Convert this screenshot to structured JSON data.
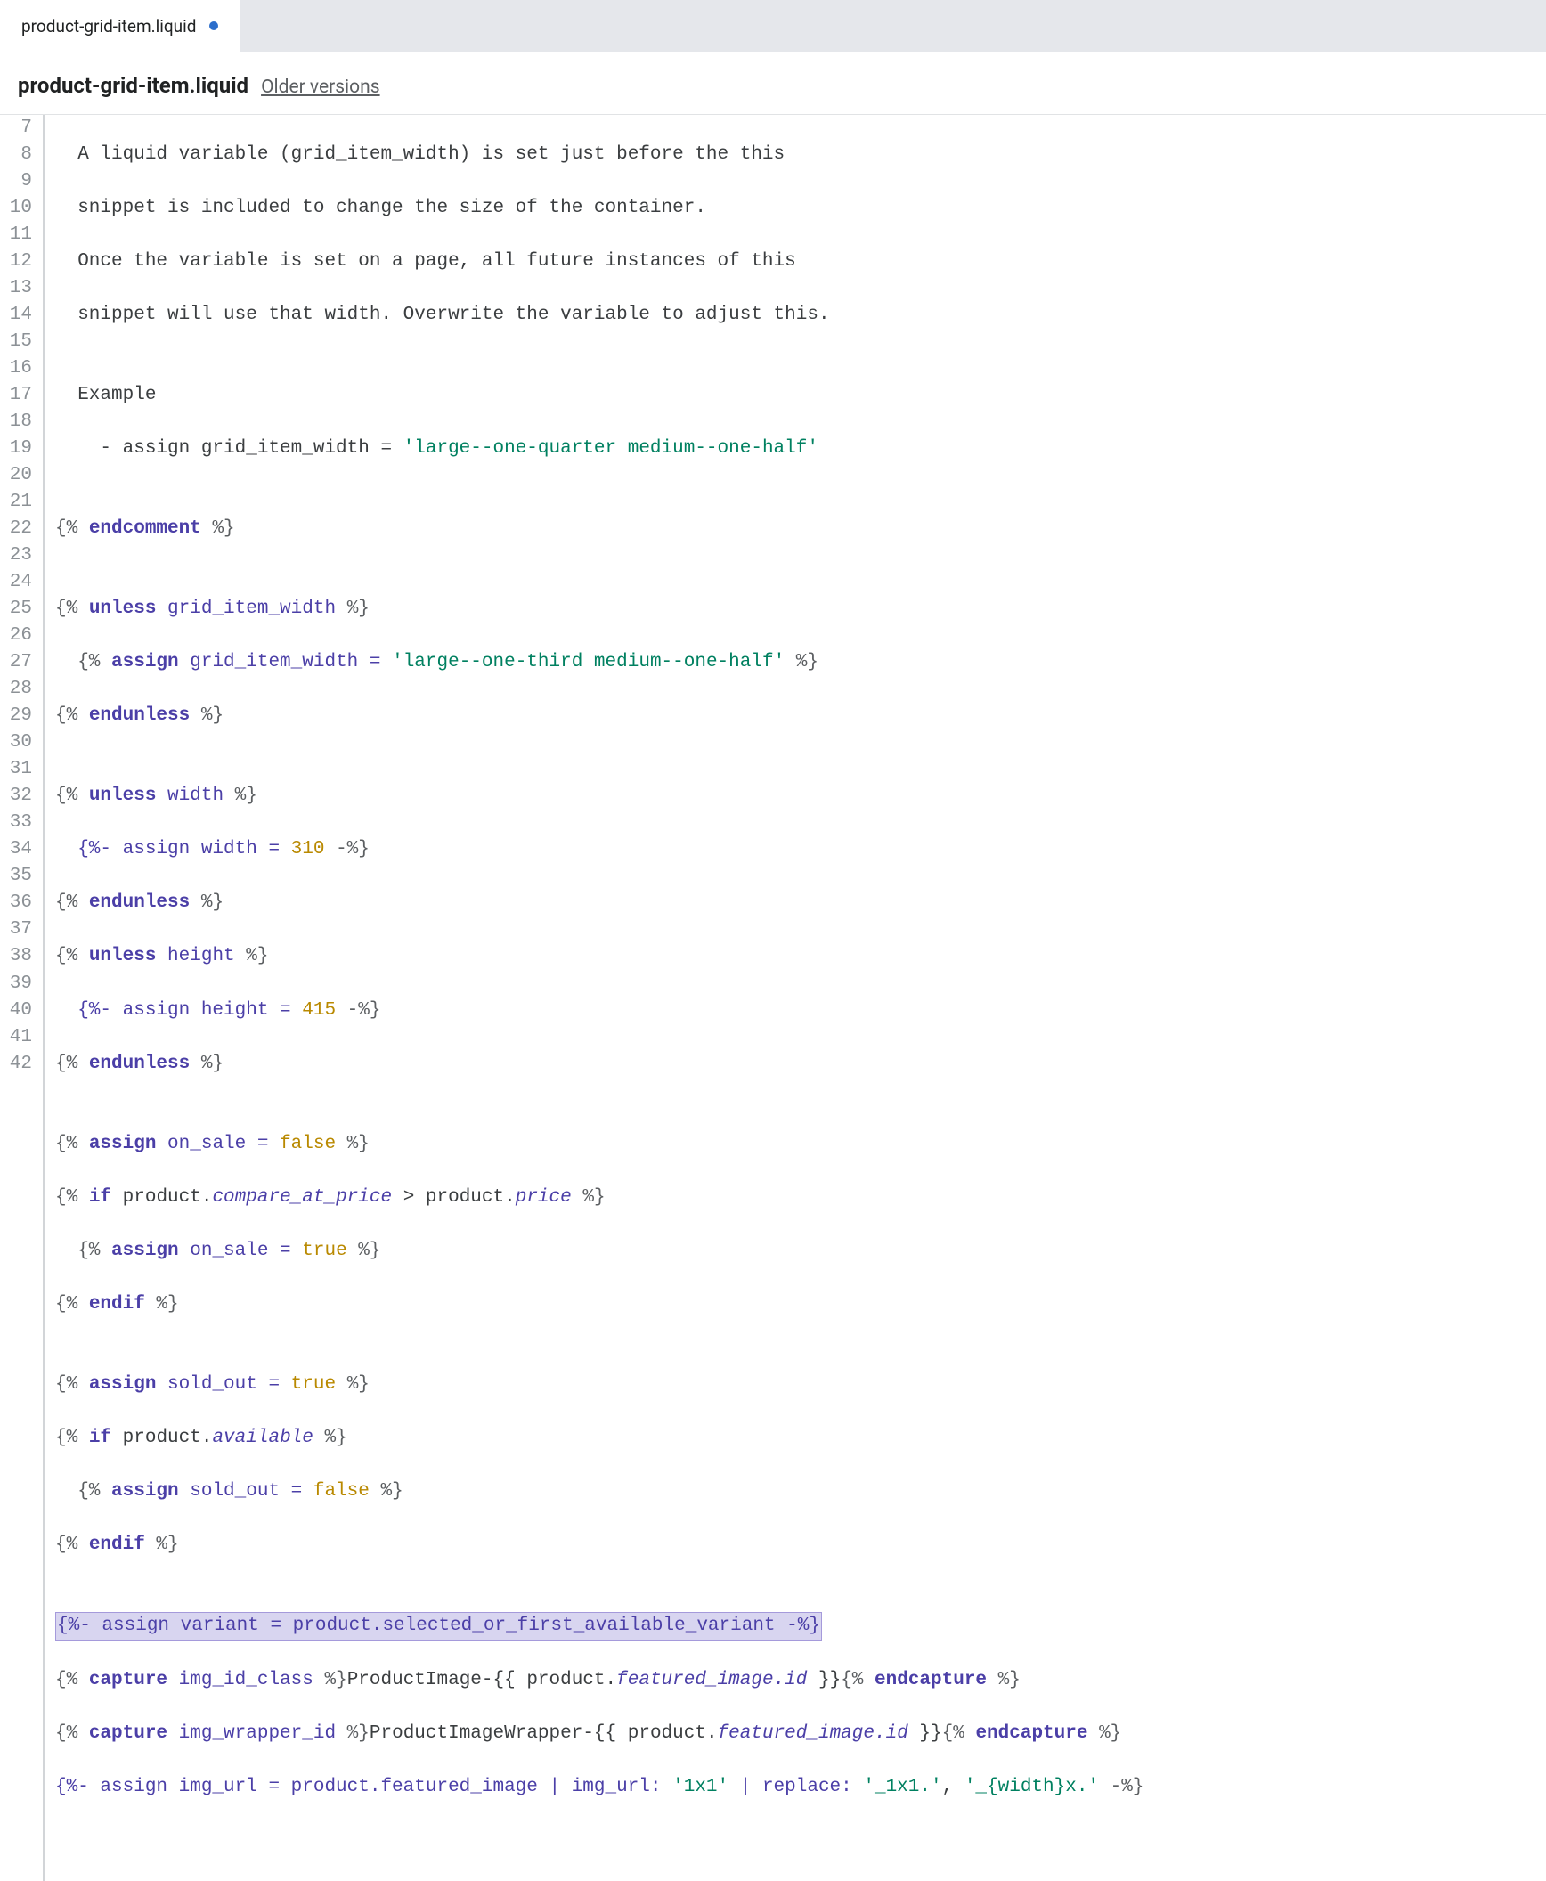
{
  "tab": {
    "label": "product-grid-item.liquid",
    "modified": true
  },
  "header": {
    "title": "product-grid-item.liquid",
    "older_versions": "Older versions"
  },
  "gutter": {
    "start": 7,
    "end": 42
  },
  "code": {
    "l7": "  A liquid variable (grid_item_width) is set just before the this",
    "l8": "  snippet is included to change the size of the container.",
    "l9": "  Once the variable is set on a page, all future instances of this",
    "l10": "  snippet will use that width. Overwrite the variable to adjust this.",
    "l11": "",
    "l12": "  Example",
    "l13_a": "    - assign grid_item_width = ",
    "l13_b": "'large--one-quarter medium--one-half'",
    "l14": "",
    "l15_a": "{% ",
    "l15_b": "endcomment",
    "l15_c": " %}",
    "l16": "",
    "l17_a": "{% ",
    "l17_b": "unless",
    "l17_c": " grid_item_width ",
    "l17_d": "%}",
    "l18_a": "  {% ",
    "l18_b": "assign",
    "l18_c": " grid_item_width = ",
    "l18_d": "'large--one-third medium--one-half'",
    "l18_e": " %}",
    "l19_a": "{% ",
    "l19_b": "endunless",
    "l19_c": " %}",
    "l20": "",
    "l21_a": "{% ",
    "l21_b": "unless",
    "l21_c": " width ",
    "l21_d": "%}",
    "l22_a": "  {%- assign width = ",
    "l22_b": "310",
    "l22_c": " -%}",
    "l23_a": "{% ",
    "l23_b": "endunless",
    "l23_c": " %}",
    "l24_a": "{% ",
    "l24_b": "unless",
    "l24_c": " height ",
    "l24_d": "%}",
    "l25_a": "  {%- assign height = ",
    "l25_b": "415",
    "l25_c": " -%}",
    "l26_a": "{% ",
    "l26_b": "endunless",
    "l26_c": " %}",
    "l27": "",
    "l28_a": "{% ",
    "l28_b": "assign",
    "l28_c": " on_sale = ",
    "l28_d": "false",
    "l28_e": " %}",
    "l29_a": "{% ",
    "l29_b": "if",
    "l29_c": " product.",
    "l29_d": "compare_at_price",
    "l29_e": " > product.",
    "l29_f": "price",
    "l29_g": " %}",
    "l30_a": "  {% ",
    "l30_b": "assign",
    "l30_c": " on_sale = ",
    "l30_d": "true",
    "l30_e": " %}",
    "l31_a": "{% ",
    "l31_b": "endif",
    "l31_c": " %}",
    "l32": "",
    "l33_a": "{% ",
    "l33_b": "assign",
    "l33_c": " sold_out = ",
    "l33_d": "true",
    "l33_e": " %}",
    "l34_a": "{% ",
    "l34_b": "if",
    "l34_c": " product.",
    "l34_d": "available",
    "l34_e": " %}",
    "l35_a": "  {% ",
    "l35_b": "assign",
    "l35_c": " sold_out = ",
    "l35_d": "false",
    "l35_e": " %}",
    "l36_a": "{% ",
    "l36_b": "endif",
    "l36_c": " %}",
    "l37": "",
    "l38": "{%- assign variant = product.selected_or_first_available_variant -%}",
    "l39_a": "{% ",
    "l39_b": "capture",
    "l39_c": " img_id_class ",
    "l39_d": "%}",
    "l39_e": "ProductImage-{{ product.",
    "l39_f": "featured_image.id",
    "l39_g": " }}",
    "l39_h": "{% ",
    "l39_i": "endcapture",
    "l39_j": " %}",
    "l40_a": "{% ",
    "l40_b": "capture",
    "l40_c": " img_wrapper_id ",
    "l40_d": "%}",
    "l40_e": "ProductImageWrapper-{{ product.",
    "l40_f": "featured_image.id",
    "l40_g": " }}",
    "l40_h": "{% ",
    "l40_i": "endcapture",
    "l40_j": " %}",
    "l41_a": "{%- assign img_url = product.featured_image | img_url: ",
    "l41_b": "'1x1'",
    "l41_c": " | replace: ",
    "l41_d": "'_1x1.'",
    "l41_e": ", ",
    "l41_f": "'_{width}x.'",
    "l41_g": " -%}",
    "l42": ""
  }
}
